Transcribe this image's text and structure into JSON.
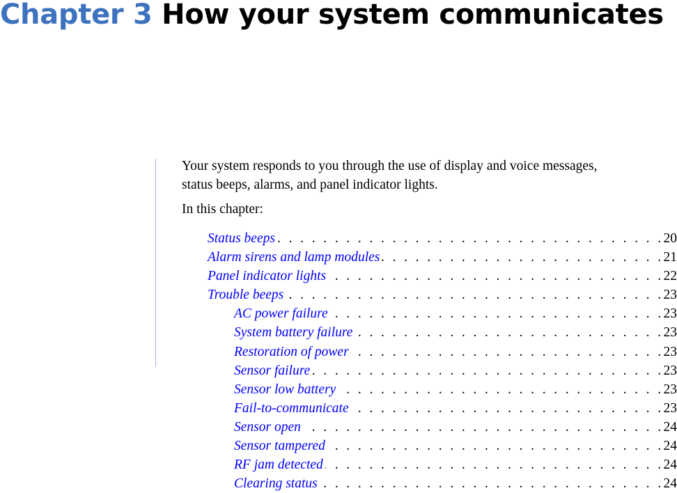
{
  "header": {
    "chapter_number": "Chapter 3",
    "chapter_title": "How your system communicates"
  },
  "body": {
    "intro": "Your system responds to you through the use of display and voice messages,",
    "intro_line2": "status beeps, alarms, and panel indicator lights.",
    "in_this_chapter": "In this chapter:"
  },
  "colors": {
    "chapter_number": "#3d72bf",
    "link": "#0000ff",
    "rule": "#a9b9dc"
  },
  "toc": [
    {
      "label": "Status beeps",
      "page": "20",
      "level": 1
    },
    {
      "label": "Alarm sirens and lamp modules",
      "page": "21",
      "level": 1
    },
    {
      "label": "Panel indicator lights",
      "page": "22",
      "level": 1
    },
    {
      "label": "Trouble beeps",
      "page": "23",
      "level": 1
    },
    {
      "label": "AC power failure",
      "page": "23",
      "level": 2
    },
    {
      "label": "System battery failure",
      "page": "23",
      "level": 2
    },
    {
      "label": "Restoration of power",
      "page": "23",
      "level": 2
    },
    {
      "label": "Sensor failure",
      "page": "23",
      "level": 2
    },
    {
      "label": "Sensor low battery",
      "page": "23",
      "level": 2
    },
    {
      "label": "Fail-to-communicate",
      "page": "23",
      "level": 2
    },
    {
      "label": "Sensor open",
      "page": "24",
      "level": 2
    },
    {
      "label": "Sensor tampered",
      "page": "24",
      "level": 2
    },
    {
      "label": "RF jam detected",
      "page": "24",
      "level": 2
    },
    {
      "label": "Clearing status",
      "page": "24",
      "level": 2
    }
  ]
}
